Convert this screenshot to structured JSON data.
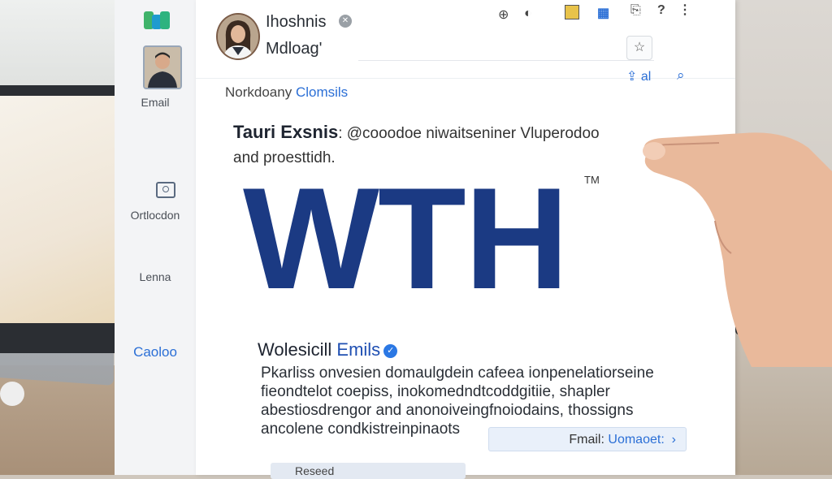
{
  "sidebar": {
    "items": [
      {
        "label": "Email"
      },
      {
        "label": "Ortlocdon"
      },
      {
        "label": "Lenna"
      },
      {
        "label": "Caoloo"
      }
    ]
  },
  "header": {
    "name": "Ihoshnis",
    "subtitle": "Mdloag'"
  },
  "breadcrumb": {
    "prefix": "Norkdoany",
    "link": "Clomsils"
  },
  "actions": {
    "share_label": "al"
  },
  "email": {
    "subject_title": "Tauri Exsnis",
    "subject_rest": ": @cooodoe niwaitseniner Vluperodoo and proesttidh.",
    "logo_text": "WTH",
    "trademark": "TM",
    "sender_name": "Wolesicill",
    "sender_highlight": "Emils",
    "body": "Pkarliss onvesien domaulgdein cafeea ionpenelatiorseine fieondtelot coepiss, inokomedndtcoddgitiie, shapler abestiosdrengor and anonoiveingfnoiodains, thossigns ancolene condkistreinpinaots",
    "email_button_prefix": "Fmail:",
    "email_button_link": "Uomaoet:",
    "footer_label": "Reseed"
  },
  "colors": {
    "accent": "#2b6fd6",
    "logo_navy": "#1b3a83",
    "verified_badge": "#2b78e4"
  }
}
